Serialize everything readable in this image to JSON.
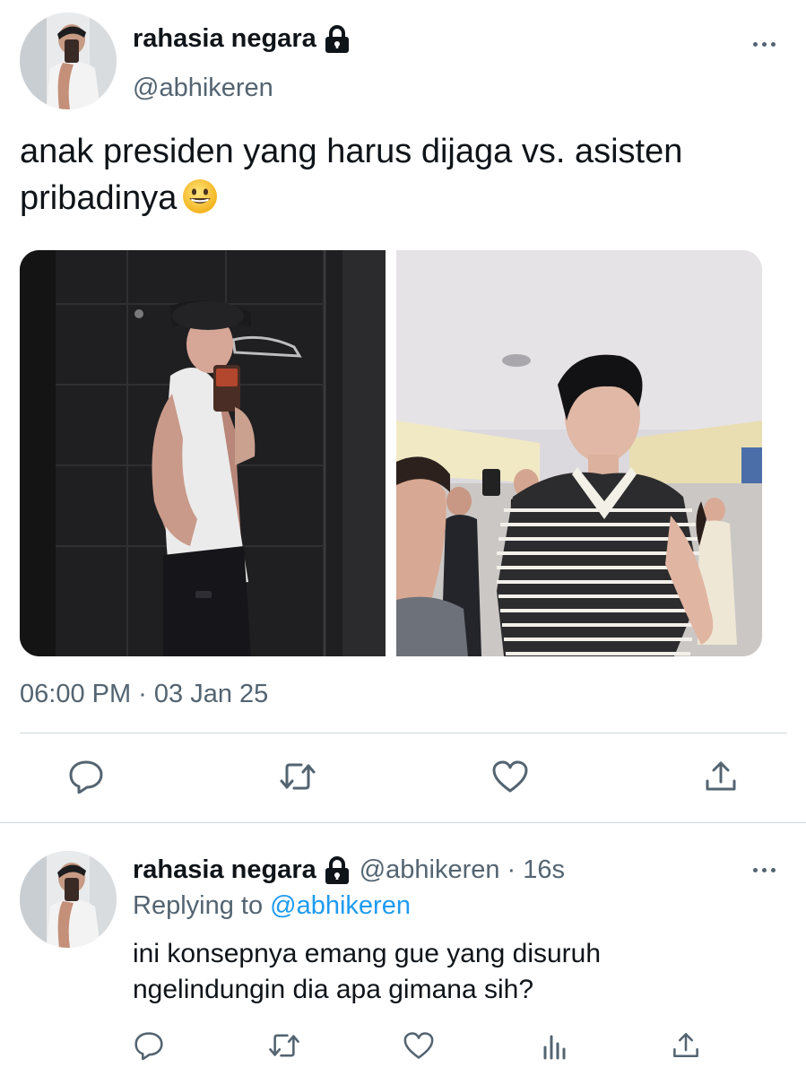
{
  "tweet": {
    "display_name": "rahasia negara",
    "handle": "@abhikeren",
    "text_line1": "anak presiden yang harus dijaga vs. asisten",
    "text_line2": "pribadinya",
    "timestamp": "06:00 PM · 03 Jan 25",
    "icons": [
      "lock-icon",
      "more-icon",
      "grinning-face-emoji",
      "reply-icon",
      "retweet-icon",
      "like-icon",
      "share-icon"
    ]
  },
  "reply": {
    "display_name": "rahasia negara",
    "handle": "@abhikeren",
    "time_sep": "·",
    "time": "16s",
    "replying_prefix": "Replying to",
    "replying_handle": "@abhikeren",
    "text_line1": "ini konsepnya emang gue yang disuruh",
    "text_line2": "ngelindungin dia apa gimana sih?",
    "icons": [
      "reply-icon",
      "retweet-icon",
      "like-icon",
      "analytics-icon",
      "share-icon"
    ]
  },
  "colors": {
    "text": "#0f1419",
    "secondary": "#536471",
    "link": "#1d9bf0",
    "divider": "#cfd9de"
  }
}
